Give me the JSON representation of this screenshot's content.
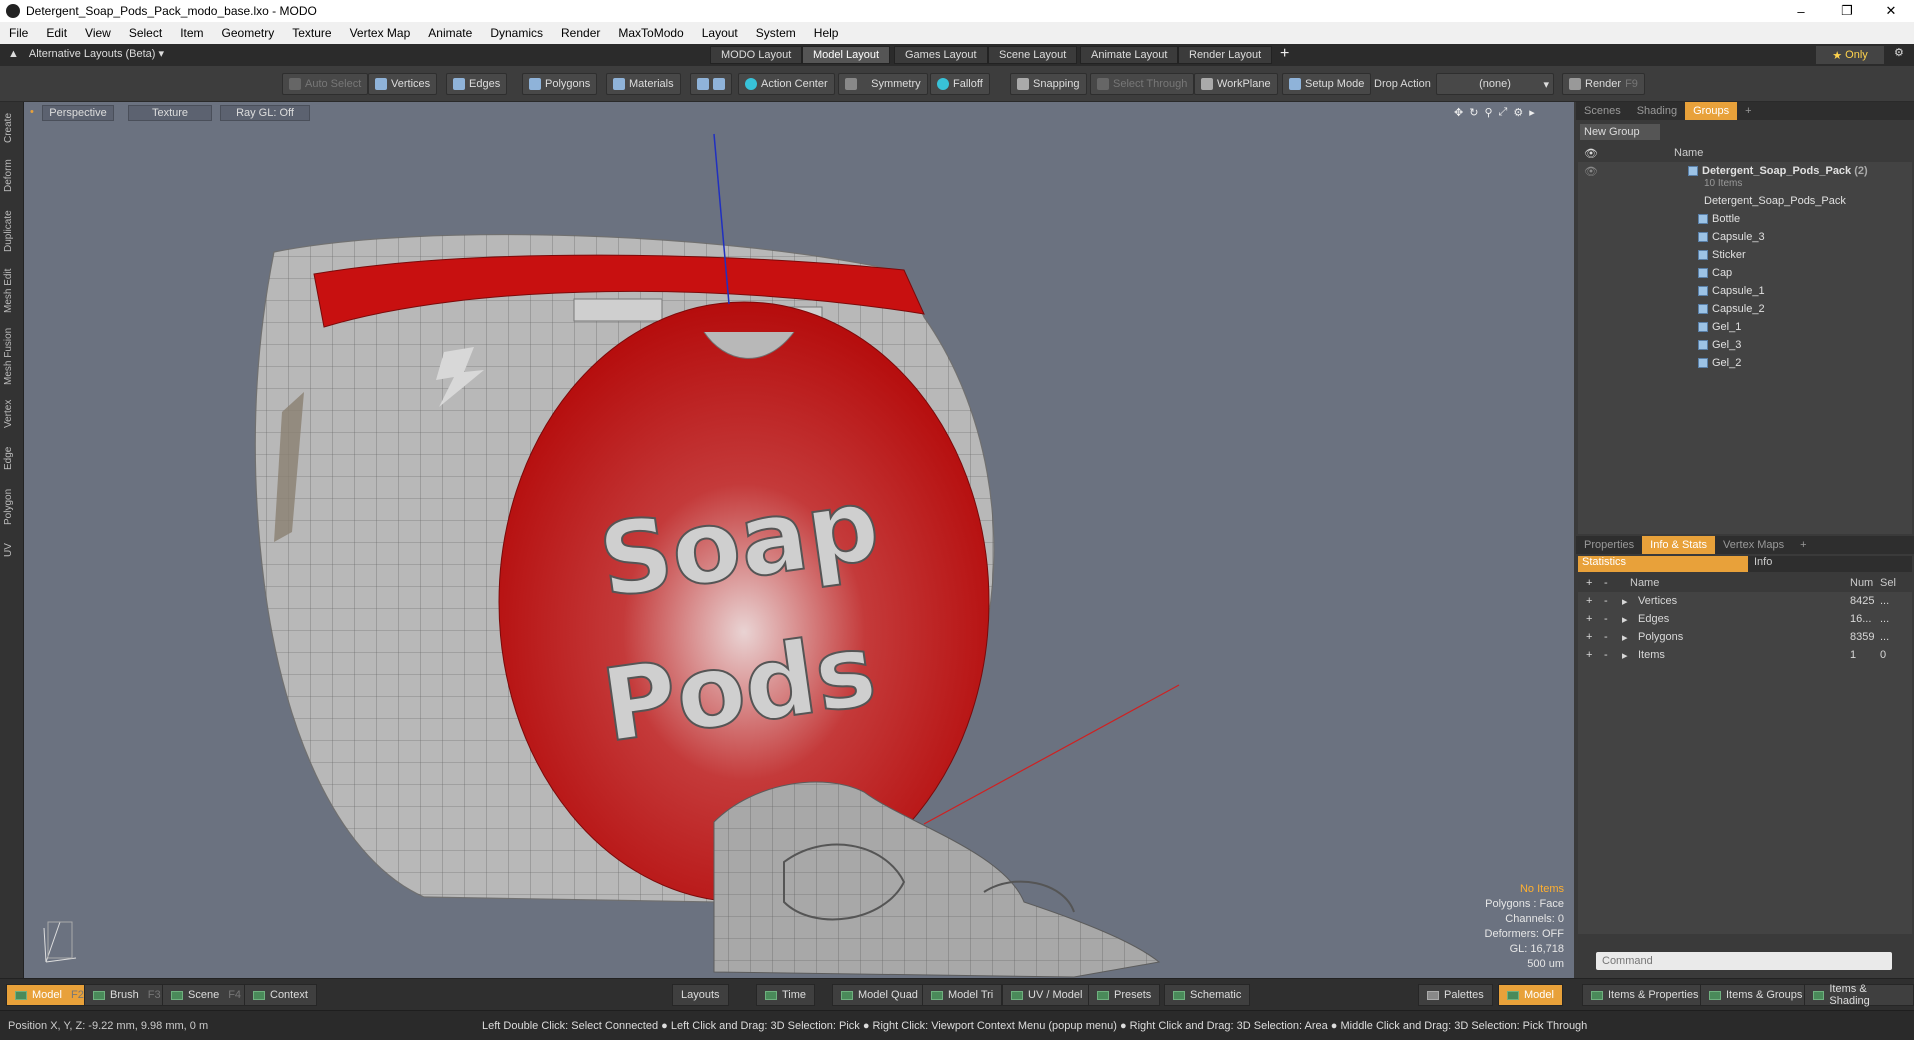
{
  "window": {
    "title": "Detergent_Soap_Pods_Pack_modo_base.lxo - MODO"
  },
  "menu": [
    "File",
    "Edit",
    "View",
    "Select",
    "Item",
    "Geometry",
    "Texture",
    "Vertex Map",
    "Animate",
    "Dynamics",
    "Render",
    "MaxToModo",
    "Layout",
    "System",
    "Help"
  ],
  "layouts": {
    "alt_label": "Alternative Layouts (Beta)",
    "tabs": [
      "MODO Layout",
      "Model Layout",
      "Games Layout",
      "Scene Layout",
      "Animate Layout",
      "Render Layout"
    ],
    "active": "Model Layout",
    "only_label": "Only"
  },
  "toolbar": {
    "auto_select": "Auto Select",
    "vertices": "Vertices",
    "edges": "Edges",
    "polygons": "Polygons",
    "materials": "Materials",
    "action_center": "Action Center",
    "symmetry": "Symmetry",
    "falloff": "Falloff",
    "snapping": "Snapping",
    "select_through": "Select Through",
    "workplane": "WorkPlane",
    "setup_mode": "Setup Mode",
    "drop_action": "Drop Action",
    "drop_value": "(none)",
    "render": "Render",
    "render_key": "F9"
  },
  "left_tabs": [
    "Create",
    "Deform",
    "Duplicate",
    "Mesh Edit",
    "Mesh Fusion",
    "Vertex",
    "Edge",
    "Polygon",
    "UV"
  ],
  "viewport": {
    "view": "Perspective",
    "shading": "Texture",
    "raygl": "Ray GL: Off",
    "label_line1": "Soap",
    "label_line2": "Pods",
    "hud": {
      "items": "No Items",
      "polygons": "Polygons : Face",
      "channels": "Channels: 0",
      "deformers": "Deformers: OFF",
      "gl": "GL: 16,718",
      "scale": "500 um"
    }
  },
  "scene_panel": {
    "tabs": [
      "Scenes",
      "Shading",
      "Groups"
    ],
    "active_tab": "Groups",
    "new_group": "New Group",
    "col_name": "Name",
    "group_name": "Detergent_Soap_Pods_Pack",
    "group_count": "(2)",
    "group_sub": "10 Items",
    "items": [
      "Detergent_Soap_Pods_Pack",
      "Bottle",
      "Capsule_3",
      "Sticker",
      "Cap",
      "Capsule_1",
      "Capsule_2",
      "Gel_1",
      "Gel_3",
      "Gel_2"
    ]
  },
  "props_panel": {
    "tabs": [
      "Properties",
      "Info & Stats",
      "Vertex Maps"
    ],
    "active_tab": "Info & Stats",
    "sub_tabs": [
      "Statistics",
      "Info"
    ],
    "columns": [
      "Name",
      "Num",
      "Sel"
    ],
    "rows": [
      {
        "name": "Vertices",
        "num": "8425",
        "sel": "..."
      },
      {
        "name": "Edges",
        "num": "16...",
        "sel": "..."
      },
      {
        "name": "Polygons",
        "num": "8359",
        "sel": "..."
      },
      {
        "name": "Items",
        "num": "1",
        "sel": "0"
      }
    ],
    "command_placeholder": "Command"
  },
  "bottom": {
    "model": "Model",
    "model_key": "F2",
    "brush": "Brush",
    "brush_key": "F3",
    "scene": "Scene",
    "scene_key": "F4",
    "context": "Context",
    "layouts": "Layouts",
    "time": "Time",
    "model_quad": "Model Quad",
    "model_tri": "Model Tri",
    "uv_model": "UV / Model",
    "presets": "Presets",
    "schematic": "Schematic",
    "palettes": "Palettes",
    "model2": "Model",
    "items_props": "Items & Properties",
    "items_groups": "Items & Groups",
    "items_shading": "Items & Shading"
  },
  "status": {
    "position": "Position X, Y, Z:   -9.22 mm, 9.98 mm, 0 m",
    "hint": "Left Double Click: Select Connected ● Left Click and Drag: 3D Selection: Pick ● Right Click: Viewport Context Menu (popup menu) ● Right Click and Drag: 3D Selection: Area ● Middle Click and Drag: 3D Selection: Pick Through"
  },
  "colors": {
    "accent": "#e8a13a",
    "viewport_bg": "#6b7280",
    "pack_red": "#c41010",
    "mesh_gray": "#a8a8a8"
  }
}
